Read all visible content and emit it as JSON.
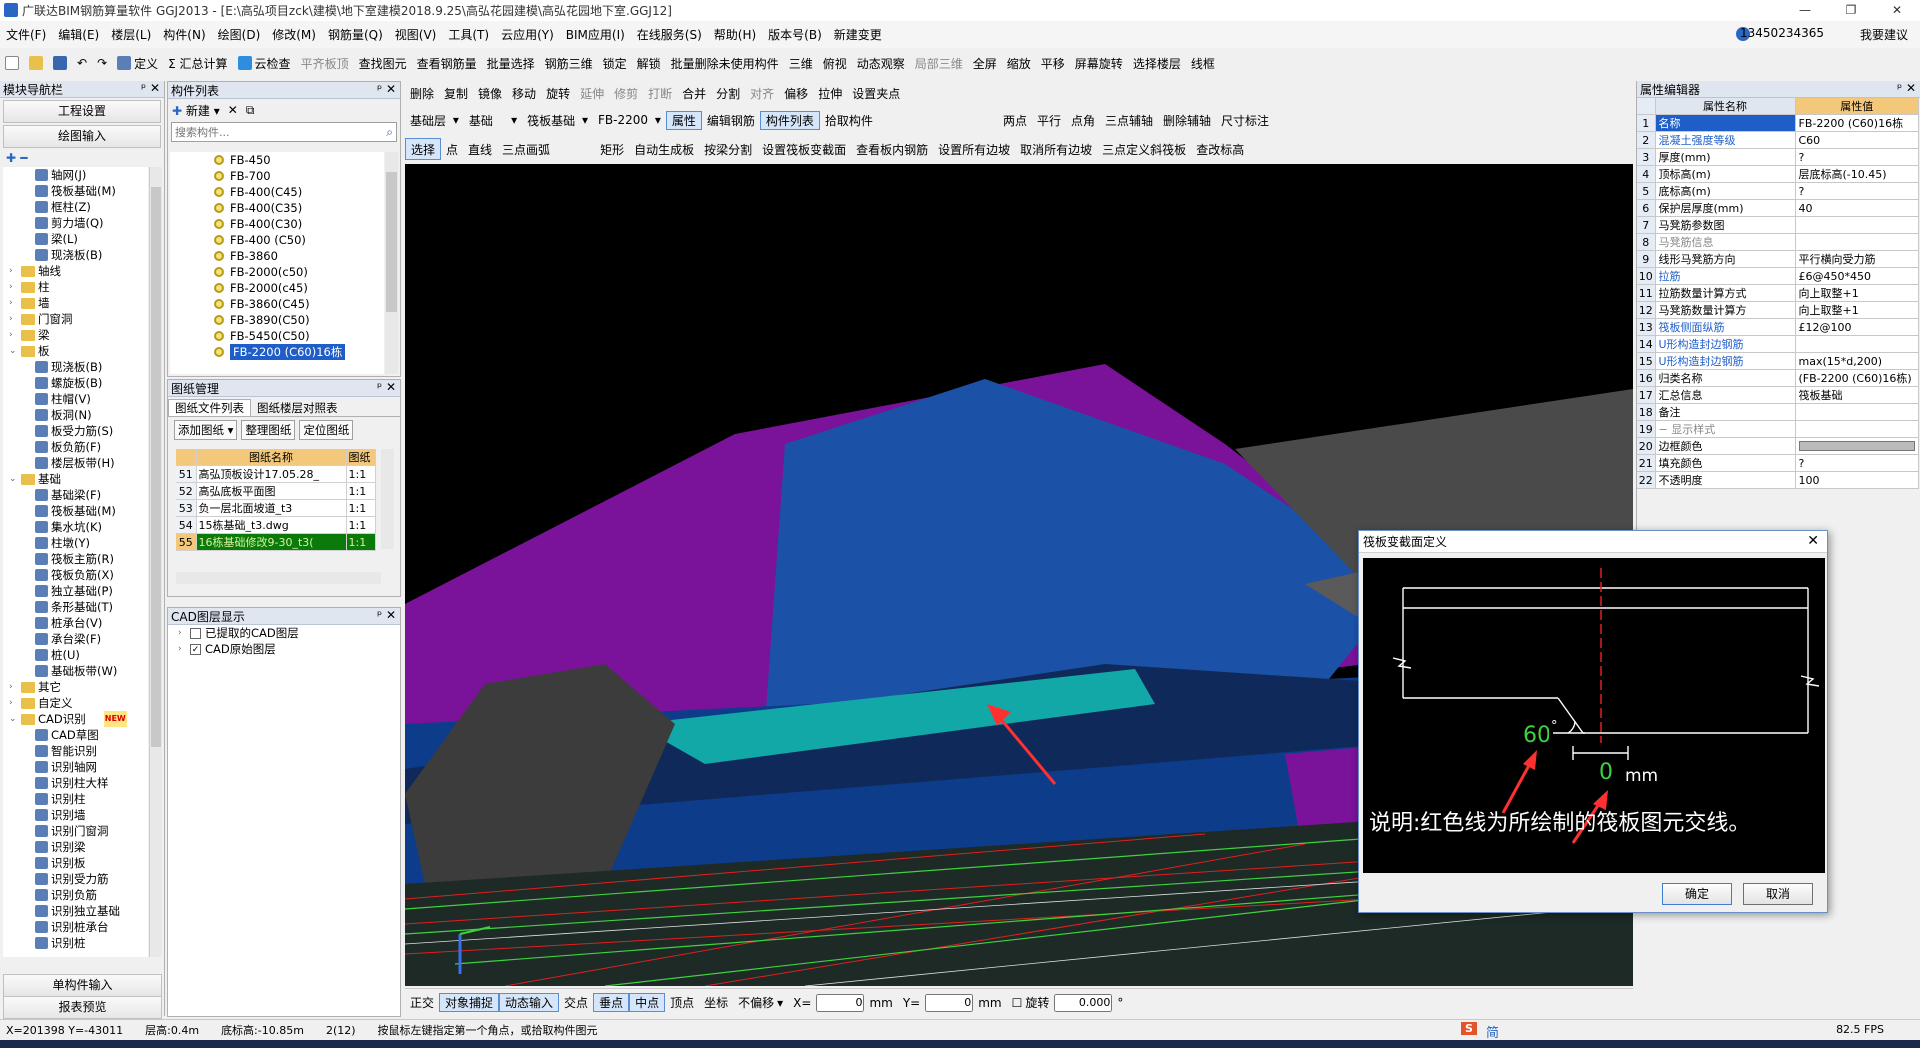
{
  "window": {
    "title": "广联达BIM钢筋算量软件 GGJ2013 - [E:\\高弘项目zck\\建模\\地下室建模2018.9.25\\高弘花园建模\\高弘花园地下室.GGJ12]"
  },
  "menu": [
    "文件(F)",
    "编辑(E)",
    "楼层(L)",
    "构件(N)",
    "绘图(D)",
    "修改(M)",
    "钢筋量(Q)",
    "视图(V)",
    "工具(T)",
    "云应用(Y)",
    "BIM应用(I)",
    "在线服务(S)",
    "帮助(H)",
    "版本号(B)",
    "新建变更"
  ],
  "account": {
    "phone": "13450234365",
    "help": "我要建议"
  },
  "toolbar1": [
    "定义",
    "Σ 汇总计算",
    "云检查",
    "平齐板顶",
    "查找图元",
    "查看钢筋量",
    "批量选择",
    "钢筋三维",
    "锁定",
    "解锁",
    "批量删除未使用构件",
    "三维",
    "俯视",
    "动态观察",
    "局部三维",
    "全屏",
    "缩放",
    "平移",
    "屏幕旋转",
    "选择楼层",
    "线框"
  ],
  "toolbar2": [
    "删除",
    "复制",
    "镜像",
    "移动",
    "旋转",
    "延伸",
    "修剪",
    "打断",
    "合并",
    "分割",
    "对齐",
    "偏移",
    "拉伸",
    "设置夹点"
  ],
  "toolbar3": {
    "floor": "基础层",
    "category": "基础",
    "type": "筏板基础",
    "element": "FB-2200",
    "items": [
      "属性",
      "编辑钢筋",
      "构件列表",
      "拾取构件",
      "两点",
      "平行",
      "点角",
      "三点辅轴",
      "删除辅轴",
      "尺寸标注"
    ]
  },
  "toolbar4": [
    "选择",
    "点",
    "直线",
    "三点画弧",
    "矩形",
    "自动生成板",
    "按梁分割",
    "设置筏板变截面",
    "查看板内钢筋",
    "设置所有边坡",
    "取消所有边坡",
    "三点定义斜筏板",
    "查改标高"
  ],
  "nav": {
    "title": "模块导航栏",
    "btn_project": "工程设置",
    "btn_draw": "绘图输入",
    "tree": [
      {
        "label": "轴网(J)",
        "lvl": 2,
        "kind": "i"
      },
      {
        "label": "筏板基础(M)",
        "lvl": 2,
        "kind": "i"
      },
      {
        "label": "框柱(Z)",
        "lvl": 2,
        "kind": "i"
      },
      {
        "label": "剪力墙(Q)",
        "lvl": 2,
        "kind": "i"
      },
      {
        "label": "梁(L)",
        "lvl": 2,
        "kind": "i"
      },
      {
        "label": "现浇板(B)",
        "lvl": 2,
        "kind": "i"
      },
      {
        "label": "轴线",
        "lvl": 1,
        "kind": "f",
        "ex": "+"
      },
      {
        "label": "柱",
        "lvl": 1,
        "kind": "f",
        "ex": "+"
      },
      {
        "label": "墙",
        "lvl": 1,
        "kind": "f",
        "ex": "+"
      },
      {
        "label": "门窗洞",
        "lvl": 1,
        "kind": "f",
        "ex": "+"
      },
      {
        "label": "梁",
        "lvl": 1,
        "kind": "f",
        "ex": "+"
      },
      {
        "label": "板",
        "lvl": 1,
        "kind": "f",
        "ex": "-"
      },
      {
        "label": "现浇板(B)",
        "lvl": 2,
        "kind": "i"
      },
      {
        "label": "螺旋板(B)",
        "lvl": 2,
        "kind": "i"
      },
      {
        "label": "柱帽(V)",
        "lvl": 2,
        "kind": "i"
      },
      {
        "label": "板洞(N)",
        "lvl": 2,
        "kind": "i"
      },
      {
        "label": "板受力筋(S)",
        "lvl": 2,
        "kind": "i"
      },
      {
        "label": "板负筋(F)",
        "lvl": 2,
        "kind": "i"
      },
      {
        "label": "楼层板带(H)",
        "lvl": 2,
        "kind": "i"
      },
      {
        "label": "基础",
        "lvl": 1,
        "kind": "f",
        "ex": "-"
      },
      {
        "label": "基础梁(F)",
        "lvl": 2,
        "kind": "i"
      },
      {
        "label": "筏板基础(M)",
        "lvl": 2,
        "kind": "i"
      },
      {
        "label": "集水坑(K)",
        "lvl": 2,
        "kind": "i"
      },
      {
        "label": "柱墩(Y)",
        "lvl": 2,
        "kind": "i"
      },
      {
        "label": "筏板主筋(R)",
        "lvl": 2,
        "kind": "i"
      },
      {
        "label": "筏板负筋(X)",
        "lvl": 2,
        "kind": "i"
      },
      {
        "label": "独立基础(P)",
        "lvl": 2,
        "kind": "i"
      },
      {
        "label": "条形基础(T)",
        "lvl": 2,
        "kind": "i"
      },
      {
        "label": "桩承台(V)",
        "lvl": 2,
        "kind": "i"
      },
      {
        "label": "承台梁(F)",
        "lvl": 2,
        "kind": "i"
      },
      {
        "label": "桩(U)",
        "lvl": 2,
        "kind": "i"
      },
      {
        "label": "基础板带(W)",
        "lvl": 2,
        "kind": "i"
      },
      {
        "label": "其它",
        "lvl": 1,
        "kind": "f",
        "ex": "+"
      },
      {
        "label": "自定义",
        "lvl": 1,
        "kind": "f",
        "ex": "+"
      },
      {
        "label": "CAD识别",
        "lvl": 1,
        "kind": "f",
        "ex": "-",
        "badge": "NEW"
      },
      {
        "label": "CAD草图",
        "lvl": 2,
        "kind": "i"
      },
      {
        "label": "智能识别",
        "lvl": 2,
        "kind": "i"
      },
      {
        "label": "识别轴网",
        "lvl": 2,
        "kind": "i"
      },
      {
        "label": "识别柱大样",
        "lvl": 2,
        "kind": "i"
      },
      {
        "label": "识别柱",
        "lvl": 2,
        "kind": "i"
      },
      {
        "label": "识别墙",
        "lvl": 2,
        "kind": "i"
      },
      {
        "label": "识别门窗洞",
        "lvl": 2,
        "kind": "i"
      },
      {
        "label": "识别梁",
        "lvl": 2,
        "kind": "i"
      },
      {
        "label": "识别板",
        "lvl": 2,
        "kind": "i"
      },
      {
        "label": "识别受力筋",
        "lvl": 2,
        "kind": "i"
      },
      {
        "label": "识别负筋",
        "lvl": 2,
        "kind": "i"
      },
      {
        "label": "识别独立基础",
        "lvl": 2,
        "kind": "i"
      },
      {
        "label": "识别桩承台",
        "lvl": 2,
        "kind": "i"
      },
      {
        "label": "识别桩",
        "lvl": 2,
        "kind": "i"
      }
    ],
    "btn_single": "单构件输入",
    "btn_report": "报表预览"
  },
  "comp": {
    "title": "构件列表",
    "new": "新建",
    "search_placeholder": "搜索构件...",
    "items": [
      "FB-450",
      "FB-700",
      "FB-400(C45)",
      "FB-400(C35)",
      "FB-400(C30)",
      "FB-400 (C50)",
      "FB-3860",
      "FB-2000(c50)",
      "FB-2000(c45)",
      "FB-3860(C45)",
      "FB-3890(C50)",
      "FB-5450(C50)",
      "FB-2200 (C60)16栋"
    ],
    "selected": 12
  },
  "drawings": {
    "title": "图纸管理",
    "tab1": "图纸文件列表",
    "tab2": "图纸楼层对照表",
    "btn_add": "添加图纸",
    "btn_sort": "整理图纸",
    "btn_locate": "定位图纸",
    "col_name": "图纸名称",
    "col_scale": "图纸",
    "rows": [
      {
        "n": "51",
        "name": "高弘顶板设计17.05.28_",
        "s": "1:1"
      },
      {
        "n": "52",
        "name": "高弘底板平面图",
        "s": "1:1"
      },
      {
        "n": "53",
        "name": "负一层北面坡道_t3",
        "s": "1:1"
      },
      {
        "n": "54",
        "name": "15栋基础_t3.dwg",
        "s": "1:1"
      },
      {
        "n": "55",
        "name": "16栋基础修改9-30_t3(",
        "s": "1:1"
      }
    ]
  },
  "cad_layers": {
    "title": "CAD图层显示",
    "item1": "已提取的CAD图层",
    "item2": "CAD原始图层"
  },
  "props": {
    "title": "属性编辑器",
    "col_name": "属性名称",
    "col_val": "属性值",
    "rows": [
      {
        "n": "1",
        "name": "名称",
        "val": "FB-2200 (C60)16栋",
        "c": "n"
      },
      {
        "n": "2",
        "name": "混凝土强度等级",
        "val": "C60",
        "c": "b"
      },
      {
        "n": "3",
        "name": "厚度(mm)",
        "val": "?",
        "c": "n"
      },
      {
        "n": "4",
        "name": "顶标高(m)",
        "val": "层底标高(-10.45)",
        "c": "n"
      },
      {
        "n": "5",
        "name": "底标高(m)",
        "val": "?",
        "c": "n"
      },
      {
        "n": "6",
        "name": "保护层厚度(mm)",
        "val": "40",
        "c": "n"
      },
      {
        "n": "7",
        "name": "马凳筋参数图",
        "val": "",
        "c": "n"
      },
      {
        "n": "8",
        "name": "马凳筋信息",
        "val": "",
        "c": "g"
      },
      {
        "n": "9",
        "name": "线形马凳筋方向",
        "val": "平行横向受力筋",
        "c": "n"
      },
      {
        "n": "10",
        "name": "拉筋",
        "val": "£6@450*450",
        "c": "b"
      },
      {
        "n": "11",
        "name": "拉筋数量计算方式",
        "val": "向上取整+1",
        "c": "n"
      },
      {
        "n": "12",
        "name": "马凳筋数量计算方",
        "val": "向上取整+1",
        "c": "n"
      },
      {
        "n": "13",
        "name": "筏板侧面纵筋",
        "val": "£12@100",
        "c": "b"
      },
      {
        "n": "14",
        "name": "U形构造封边钢筋",
        "val": "",
        "c": "b"
      },
      {
        "n": "15",
        "name": "U形构造封边钢筋",
        "val": "max(15*d,200)",
        "c": "b"
      },
      {
        "n": "16",
        "name": "归类名称",
        "val": "(FB-2200 (C60)16栋)",
        "c": "n"
      },
      {
        "n": "17",
        "name": "汇总信息",
        "val": "筏板基础",
        "c": "n"
      },
      {
        "n": "18",
        "name": "备注",
        "val": "",
        "c": "n"
      },
      {
        "n": "19",
        "name": "− 显示样式",
        "val": "",
        "c": "g"
      },
      {
        "n": "20",
        "name": "边框颜色",
        "val": "",
        "c": "n"
      },
      {
        "n": "21",
        "name": "填充颜色",
        "val": "?",
        "c": "n"
      },
      {
        "n": "22",
        "name": "不透明度",
        "val": "100",
        "c": "n"
      }
    ]
  },
  "dialog": {
    "title": "筏板变截面定义",
    "angle": "60",
    "degree": "°",
    "offset": "0",
    "unit": "mm",
    "note": "说明:红色线为所绘制的筏板图元交线。",
    "ok": "确定",
    "cancel": "取消"
  },
  "bottombar": {
    "items": [
      "正交",
      "对象捕捉",
      "动态输入",
      "交点",
      "垂点",
      "中点",
      "顶点",
      "坐标"
    ],
    "offset": "不偏移",
    "x_label": "X=",
    "x_val": "0",
    "y_label": "Y=",
    "y_val": "0",
    "mm": "mm",
    "rotate": "旋转",
    "rotate_val": "0.000",
    "deg": "°"
  },
  "status": {
    "coord": "X=201398 Y=-43011",
    "floor_h": "层高:0.4m",
    "bottom": "底标高:-10.85m",
    "count": "2(12)",
    "hint": "按鼠标左键指定第一个角点，或拾取构件图元",
    "fps": "82.5 FPS"
  },
  "ime": "简",
  "colors": {
    "accent": "#1f5ec9",
    "viewport": "#000000",
    "selected_row": "#0a7a0a",
    "header_orange": "#f3c87a"
  }
}
